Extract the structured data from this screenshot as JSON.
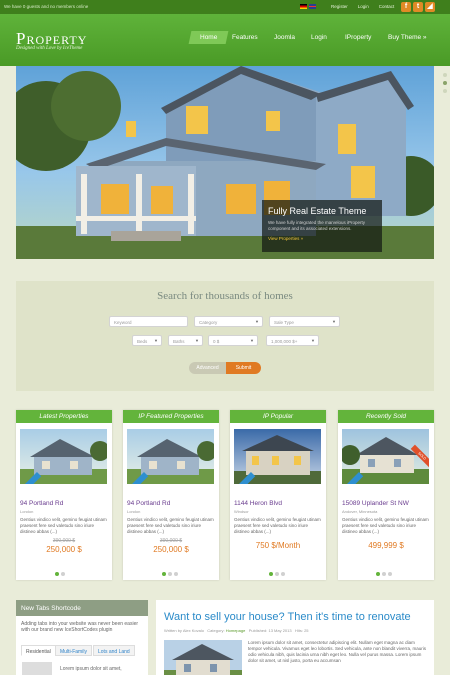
{
  "topbar": {
    "message": "We have 0 guests and no members online",
    "links": [
      "Register",
      "Login",
      "Contact"
    ],
    "social": [
      "f",
      "t",
      "rss"
    ]
  },
  "header": {
    "logo": "Property",
    "tagline": "Designed with Love by IceTheme",
    "nav": [
      "Home",
      "Features",
      "Joomla",
      "Login",
      "IProperty",
      "Buy Theme »"
    ]
  },
  "slider": {
    "caption_title": "Fully Real Estate Theme",
    "caption_text": "We have fully integrated the marvelous iProperty component and its associated extensions.",
    "caption_link": "View Properties »"
  },
  "search": {
    "title": "Search for thousands of homes",
    "keyword_placeholder": "Keyword",
    "category": "Category",
    "sale_type": "Sale Type",
    "beds": "Beds",
    "baths": "Baths",
    "min_price": "0 $",
    "max_price": "1,000,000 $+",
    "advanced": "Advanced",
    "submit": "Submit"
  },
  "cards": [
    {
      "heading": "Latest Properties",
      "title": "94 Portland Rd",
      "location": "London",
      "desc": "Gentius vindico velit, gemino feugiat utinam praesent fere sed valetudo sino iriure distineo abbas (...)",
      "old_price": "390,000 $",
      "price": "250,000 $"
    },
    {
      "heading": "IP Featured Properties",
      "title": "94 Portland Rd",
      "location": "London",
      "desc": "Gentius vindico velit, gemino feugiat utinam praesent fere sed valetudo sino iriure distineo abbas (...)",
      "old_price": "390,000 $",
      "price": "250,000 $"
    },
    {
      "heading": "IP Popular",
      "title": "1144 Heron Blvd",
      "location": "Windsor",
      "desc": "Gentius vindico velit, gemino feugiat utinam praesent fere sed valetudo sino iriure distineo abbas (...)",
      "price": "750 $/Month"
    },
    {
      "heading": "Recently Sold",
      "title": "15089 Uplander St NW",
      "location": "Andover, Minnesota",
      "desc": "Gentius vindico velit, gemino feugiat utinam praesent fere sed valetudo sino iriure distineo abbas (...)",
      "price": "499,999 $",
      "ribbon": "SOLD"
    }
  ],
  "tabsbox": {
    "heading": "New Tabs Shortcode",
    "text": "Adding tabs into your website was never been easier with our brand new IceShortCodes plugin",
    "tabs": [
      "Residential",
      "Multi-Family",
      "Lots and Land"
    ],
    "content": "Lorem ipsum dolor sit amet,"
  },
  "sell": {
    "heading": "Want to sell your house? Then it's time to renovate",
    "written_by": "Written by Alex Kovalo",
    "category_label": "Category:",
    "category": "Homepage",
    "published": "Published: 13 May 2013",
    "hits": "Hits: 25",
    "body": "Lorem ipsum dolor sit amet, consectetur adipiscing elit. Nullam eget magna ac diam tempor vehicula. Vivamus eget leo lobortis. Sed vehicula, ante non blandit viverra, mauris odio vehicula nibh, quis lacinia urna nibh eget leo. Nulla vel purus massa. Lorem ipsum dolor sit amet, ut nisl justo, porta eu accumsan"
  },
  "colors": {
    "brand_green": "#5fb33a",
    "accent_orange": "#e07a23",
    "link_blue": "#2b8bc9"
  }
}
